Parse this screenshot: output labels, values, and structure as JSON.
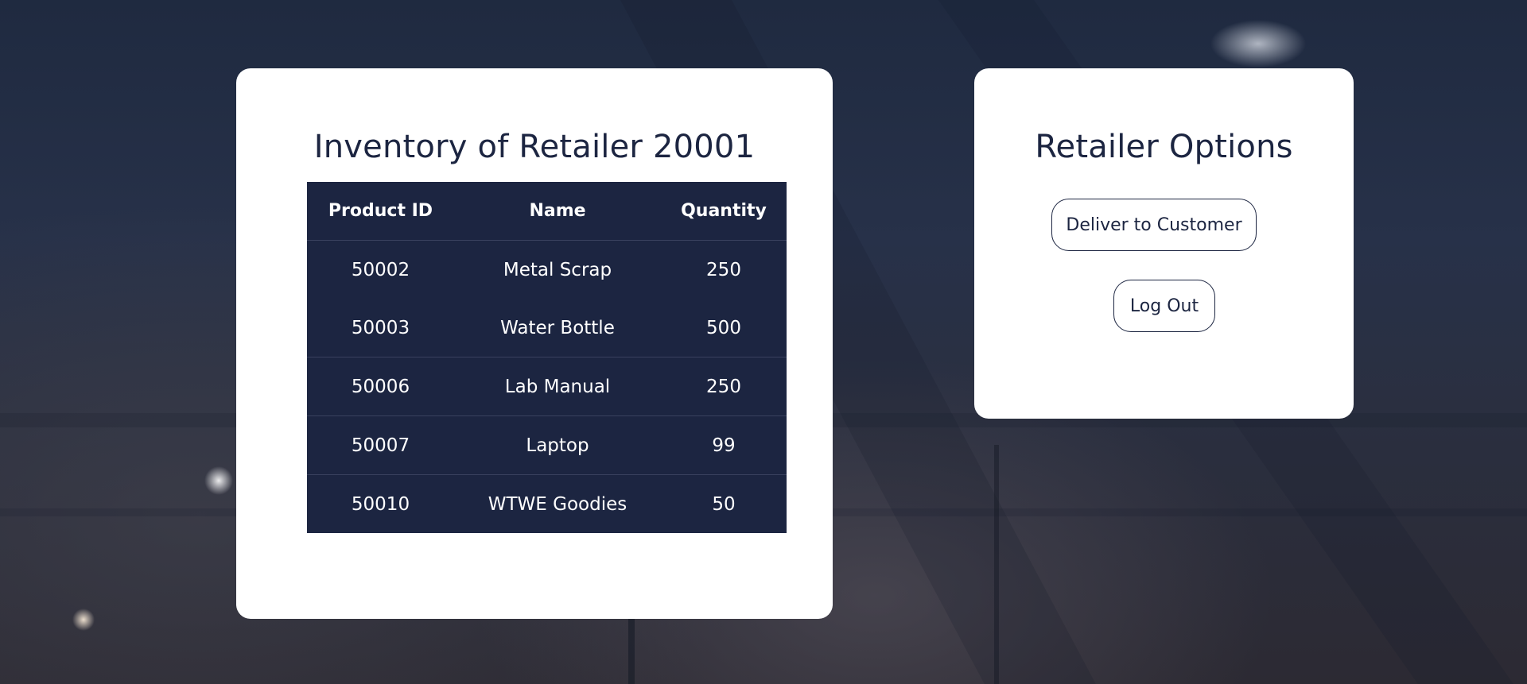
{
  "inventory": {
    "title": "Inventory of Retailer 20001",
    "columns": [
      "Product ID",
      "Name",
      "Quantity"
    ],
    "rows": [
      {
        "product_id": "50002",
        "name": "Metal Scrap",
        "quantity": "250"
      },
      {
        "product_id": "50003",
        "name": "Water Bottle",
        "quantity": "500"
      },
      {
        "product_id": "50006",
        "name": "Lab Manual",
        "quantity": "250"
      },
      {
        "product_id": "50007",
        "name": "Laptop",
        "quantity": "99"
      },
      {
        "product_id": "50010",
        "name": "WTWE Goodies",
        "quantity": "50"
      }
    ]
  },
  "options": {
    "title": "Retailer Options",
    "deliver_label": "Deliver to Customer",
    "logout_label": "Log Out"
  },
  "colors": {
    "primary": "#1c2541",
    "card_background": "#ffffff",
    "table_text": "#ffffff"
  }
}
